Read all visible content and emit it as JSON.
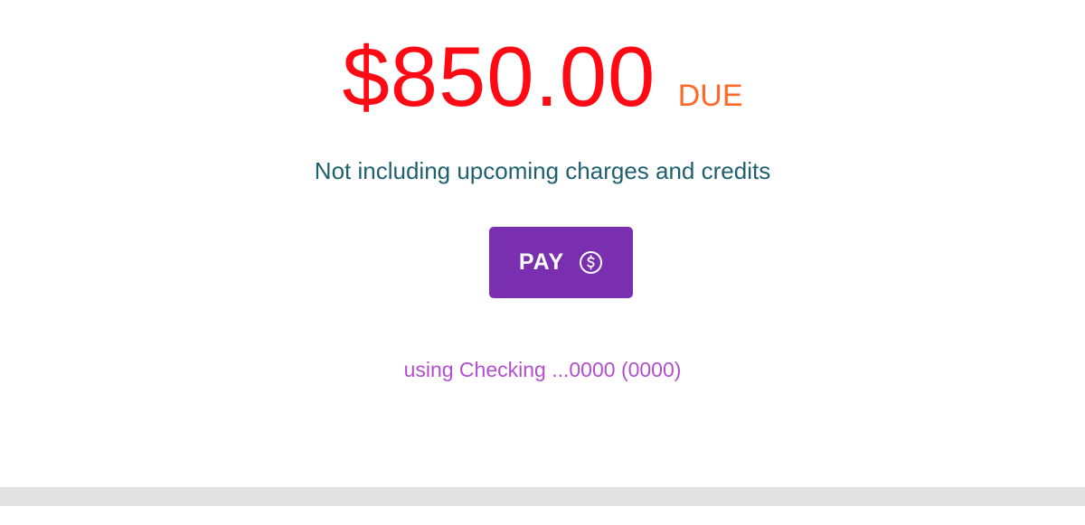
{
  "balance": {
    "amount": "$850.00",
    "status": "DUE",
    "note": "Not including upcoming charges and credits"
  },
  "pay_button": {
    "label": "PAY",
    "icon": "dollar-circle-icon"
  },
  "payment_method": {
    "text": "using Checking ...0000 (0000)"
  },
  "colors": {
    "amount": "#ff0a14",
    "due": "#ff6a2a",
    "note": "#1f6070",
    "button_bg": "#7a2fb1",
    "account_link": "#b34fcf",
    "footer_bar": "#e2e2e2"
  }
}
